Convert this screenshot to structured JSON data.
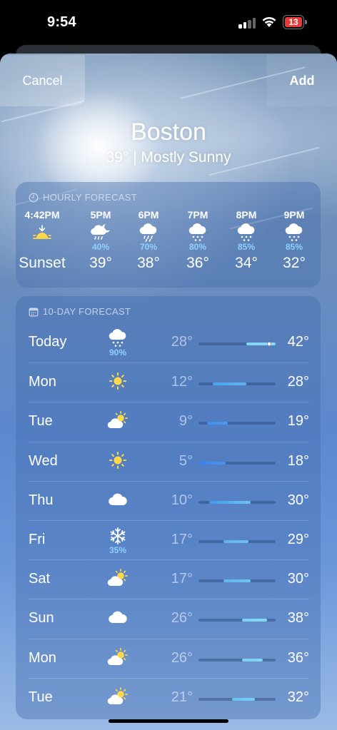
{
  "status_bar": {
    "time": "9:54",
    "battery": "13"
  },
  "header": {
    "cancel_label": "Cancel",
    "add_label": "Add"
  },
  "location": {
    "city": "Boston",
    "summary": "39°  |  Mostly Sunny"
  },
  "hourly": {
    "title": "HOURLY FORECAST",
    "items": [
      {
        "hour": "4:42PM",
        "icon": "sunset-icon",
        "pct": "",
        "temp": "Sunset"
      },
      {
        "hour": "5PM",
        "icon": "rain-moon-icon",
        "pct": "40%",
        "temp": "39°"
      },
      {
        "hour": "6PM",
        "icon": "rain-icon",
        "pct": "70%",
        "temp": "38°"
      },
      {
        "hour": "7PM",
        "icon": "snow-icon",
        "pct": "80%",
        "temp": "36°"
      },
      {
        "hour": "8PM",
        "icon": "snow-icon",
        "pct": "85%",
        "temp": "34°"
      },
      {
        "hour": "9PM",
        "icon": "snow-icon",
        "pct": "85%",
        "temp": "32°"
      }
    ]
  },
  "daily": {
    "title": "10-DAY FORECAST",
    "range_min": 5,
    "range_max": 42,
    "current_temp": 39,
    "items": [
      {
        "day": "Today",
        "icon": "snow-icon",
        "pct": "90%",
        "low": "28°",
        "high": "42°",
        "low_val": 28,
        "high_val": 42,
        "bar_from": "#7ed7f5",
        "bar_to": "#8ad9f7"
      },
      {
        "day": "Mon",
        "icon": "sun-icon",
        "pct": "",
        "low": "12°",
        "high": "28°",
        "low_val": 12,
        "high_val": 28,
        "bar_from": "#4aa3ec",
        "bar_to": "#62b4f0"
      },
      {
        "day": "Tue",
        "icon": "partly-cloudy-icon",
        "pct": "",
        "low": "9°",
        "high": "19°",
        "low_val": 9,
        "high_val": 19,
        "bar_from": "#3e8ff0",
        "bar_to": "#4d9ef0"
      },
      {
        "day": "Wed",
        "icon": "sun-icon",
        "pct": "",
        "low": "5°",
        "high": "18°",
        "low_val": 5,
        "high_val": 18,
        "bar_from": "#3a7ff0",
        "bar_to": "#4a96f0"
      },
      {
        "day": "Thu",
        "icon": "cloud-icon",
        "pct": "",
        "low": "10°",
        "high": "30°",
        "low_val": 10,
        "high_val": 30,
        "bar_from": "#4296f0",
        "bar_to": "#6ec3f2"
      },
      {
        "day": "Fri",
        "icon": "snowflake-icon",
        "pct": "35%",
        "low": "17°",
        "high": "29°",
        "low_val": 17,
        "high_val": 29,
        "bar_from": "#5eb3ef",
        "bar_to": "#6dc0f0"
      },
      {
        "day": "Sat",
        "icon": "partly-cloudy-icon",
        "pct": "",
        "low": "17°",
        "high": "30°",
        "low_val": 17,
        "high_val": 30,
        "bar_from": "#5eb3ef",
        "bar_to": "#70c4f0"
      },
      {
        "day": "Sun",
        "icon": "cloud-icon",
        "pct": "",
        "low": "26°",
        "high": "38°",
        "low_val": 26,
        "high_val": 38,
        "bar_from": "#7ad2f2",
        "bar_to": "#86d8f4"
      },
      {
        "day": "Mon",
        "icon": "partly-cloudy-icon",
        "pct": "",
        "low": "26°",
        "high": "36°",
        "low_val": 26,
        "high_val": 36,
        "bar_from": "#7ad2f2",
        "bar_to": "#84d6f4"
      },
      {
        "day": "Tue",
        "icon": "partly-cloudy-icon",
        "pct": "",
        "low": "21°",
        "high": "32°",
        "low_val": 21,
        "high_val": 32,
        "bar_from": "#68c2f0",
        "bar_to": "#7ccff2"
      }
    ]
  }
}
